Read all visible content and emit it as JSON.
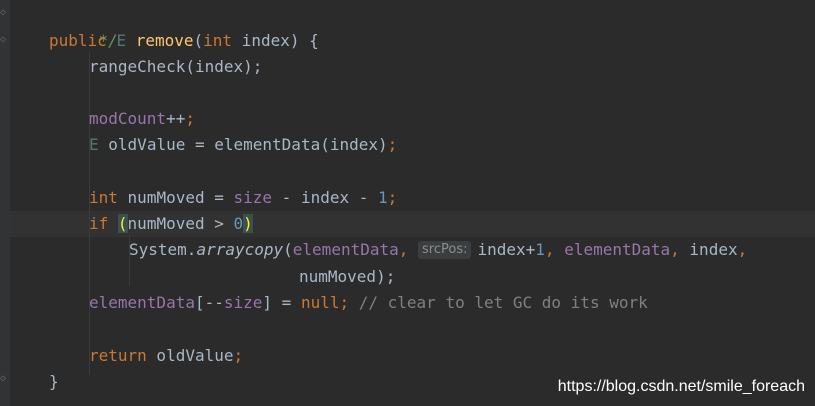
{
  "code": {
    "comment_end": "*/",
    "kw_public": "public",
    "type_e": "E",
    "method_name": "remove",
    "kw_int": "int",
    "param": "index",
    "range_check": "rangeCheck(index);",
    "mod_count": "modCount",
    "inc": "++",
    "semi": ";",
    "old_value_decl": "oldValue = elementData(index)",
    "num_moved_decl": "numMoved = ",
    "size": "size",
    "minus_index": " - index - ",
    "one": "1",
    "kw_if": "if",
    "num_moved_cond": "numMoved > ",
    "zero": "0",
    "system": "System.",
    "arraycopy": "arraycopy",
    "element_data": "elementData",
    "comma": ", ",
    "src_pos_hint": "srcPos:",
    "index_plus": "index+",
    "index_word": "index",
    "num_moved": "numMoved",
    "close_paren_semi": ");",
    "element_data_open": "[--",
    "eq": "] = ",
    "kw_null": "null",
    "gc_comment": "// clear to let GC do its work",
    "kw_return": "return",
    "old_value": " oldValue",
    "closing_brace": "}"
  },
  "watermark": "https://blog.csdn.net/smile_foreach"
}
